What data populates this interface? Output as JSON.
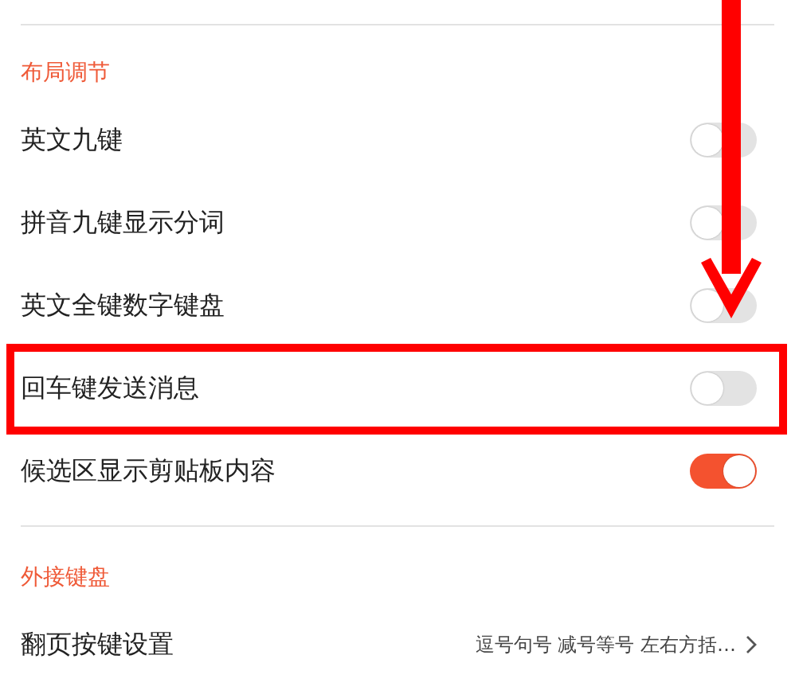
{
  "sections": [
    {
      "title": "布局调节",
      "rows": [
        {
          "kind": "toggle",
          "label": "英文九键",
          "on": false
        },
        {
          "kind": "toggle",
          "label": "拼音九键显示分词",
          "on": false
        },
        {
          "kind": "toggle",
          "label": "英文全键数字键盘",
          "on": false
        },
        {
          "kind": "toggle",
          "label": "回车键发送消息",
          "on": false,
          "highlighted": true
        },
        {
          "kind": "toggle",
          "label": "候选区显示剪贴板内容",
          "on": true
        }
      ]
    },
    {
      "title": "外接键盘",
      "rows": [
        {
          "kind": "link",
          "label": "翻页按键设置",
          "value": "逗号句号 减号等号 左右方括…"
        }
      ]
    }
  ]
}
